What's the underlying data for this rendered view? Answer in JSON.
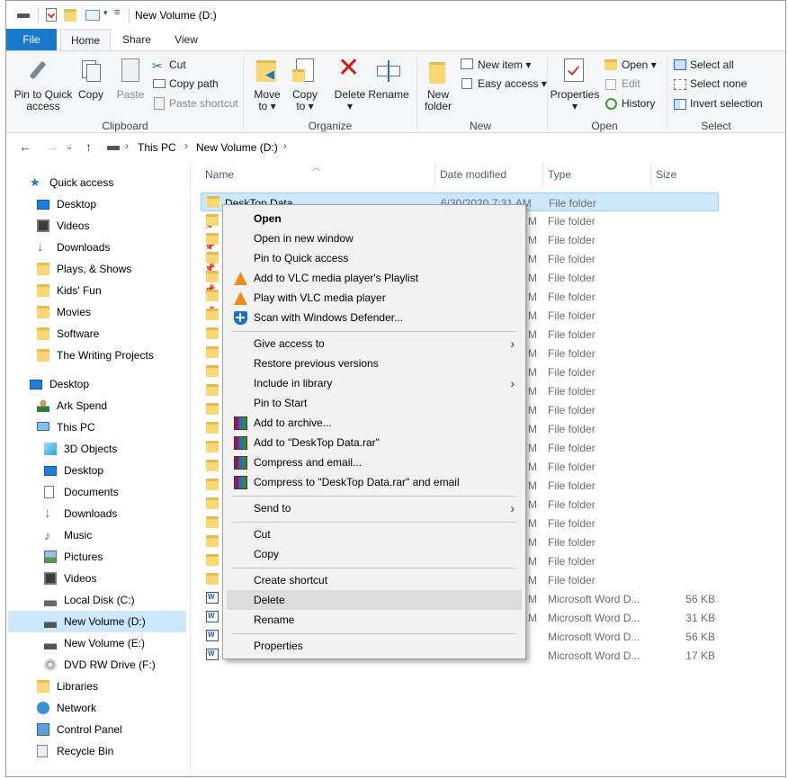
{
  "window": {
    "title": "New Volume (D:)"
  },
  "ribbon": {
    "tabs": {
      "file": "File",
      "home": "Home",
      "share": "Share",
      "view": "View"
    },
    "clipboard": {
      "label": "Clipboard",
      "pin_line1": "Pin to Quick",
      "pin_line2": "access",
      "copy": "Copy",
      "paste": "Paste",
      "cut": "Cut",
      "copy_path": "Copy path",
      "paste_shortcut": "Paste shortcut"
    },
    "organize": {
      "label": "Organize",
      "move_line1": "Move",
      "move_line2": "to ▾",
      "copy_line1": "Copy",
      "copy_line2": "to ▾",
      "delete": "Delete",
      "delete_arrow": "▾",
      "rename": "Rename"
    },
    "new": {
      "label": "New",
      "folder_line1": "New",
      "folder_line2": "folder",
      "new_item": "New item ▾",
      "easy_access": "Easy access ▾"
    },
    "open": {
      "label": "Open",
      "properties": "Properties",
      "properties_arrow": "▾",
      "open": "Open ▾",
      "edit": "Edit",
      "history": "History"
    },
    "select": {
      "label": "Select",
      "select_all": "Select all",
      "select_none": "Select none",
      "invert": "Invert selection"
    }
  },
  "address": {
    "path": [
      "This PC",
      "New Volume (D:)"
    ],
    "sep": "›"
  },
  "nav": {
    "quick_access": "Quick access",
    "quick_items": [
      "Desktop",
      "Videos",
      "Downloads",
      "Plays, & Shows",
      "Kids' Fun",
      "Movies",
      "Software",
      "The Writing Projects"
    ],
    "desktop": "Desktop",
    "user": "Ark Spend",
    "this_pc": "This PC",
    "pc_items": [
      "3D Objects",
      "Desktop",
      "Documents",
      "Downloads",
      "Music",
      "Pictures",
      "Videos",
      "Local Disk (C:)",
      "New Volume (D:)",
      "New Volume (E:)",
      "DVD RW Drive (F:)"
    ],
    "libraries": "Libraries",
    "network": "Network",
    "control_panel": "Control Panel",
    "recycle_bin": "Recycle Bin"
  },
  "list": {
    "columns": {
      "name": "Name",
      "date": "Date modified",
      "type": "Type",
      "size": "Size"
    },
    "selected_name": "DeskTop Data",
    "selected_date": "6/30/2020 7:31 AM",
    "folder_type": "File folder",
    "word_type": "Microsoft Word D...",
    "word_sizes": [
      "56 KB",
      "31 KB",
      "56 KB",
      "17 KB"
    ],
    "m_marks": [
      "M",
      "M",
      "M",
      "M",
      "M",
      "M",
      "M",
      "M",
      "M",
      "M",
      "M",
      "M",
      "M",
      "M",
      "M",
      "M",
      "M",
      "M",
      "M",
      "M",
      "M",
      "M"
    ]
  },
  "context_menu": {
    "open": "Open",
    "open_new_window": "Open in new window",
    "pin_quick": "Pin to Quick access",
    "vlc_playlist": "Add to VLC media player's Playlist",
    "vlc_play": "Play with VLC media player",
    "defender": "Scan with Windows Defender...",
    "give_access": "Give access to",
    "restore": "Restore previous versions",
    "include_library": "Include in library",
    "pin_start": "Pin to Start",
    "add_archive": "Add to archive...",
    "add_rar": "Add to \"DeskTop Data.rar\"",
    "compress_email": "Compress and email...",
    "compress_rar_email": "Compress to \"DeskTop Data.rar\" and email",
    "send_to": "Send to",
    "cut": "Cut",
    "copy": "Copy",
    "create_shortcut": "Create shortcut",
    "delete": "Delete",
    "rename": "Rename",
    "properties": "Properties"
  },
  "colors": {
    "accent": "#1979ca",
    "selection": "#cce8ff",
    "menu_bg": "#f2f2f2",
    "folder": "#f8d775"
  }
}
